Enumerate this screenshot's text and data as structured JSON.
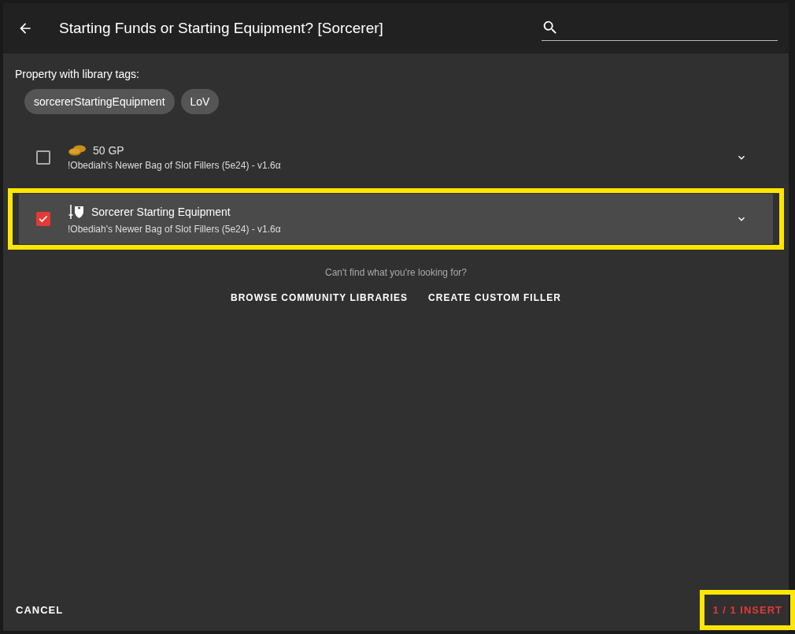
{
  "dialog": {
    "title": "Starting Funds or Starting Equipment? [Sorcerer]"
  },
  "tags_label": "Property with library tags:",
  "tags": [
    "sorcererStartingEquipment",
    "LoV"
  ],
  "items": [
    {
      "kind": "coins",
      "name": "50 GP",
      "library": "!Obediah's Newer Bag of Slot Fillers (5e24) - v1.6α",
      "checked": false,
      "selected": false,
      "highlighted": false
    },
    {
      "kind": "equipment",
      "name": "Sorcerer Starting Equipment",
      "library": "!Obediah's Newer Bag of Slot Fillers (5e24) - v1.6α",
      "checked": true,
      "selected": true,
      "highlighted": true
    }
  ],
  "hint": "Can't find what you're looking for?",
  "links": [
    "BROWSE COMMUNITY LIBRARIES",
    "CREATE CUSTOM FILLER"
  ],
  "footer": {
    "cancel": "CANCEL",
    "insert": "1 / 1 INSERT",
    "insert_highlighted": true
  }
}
